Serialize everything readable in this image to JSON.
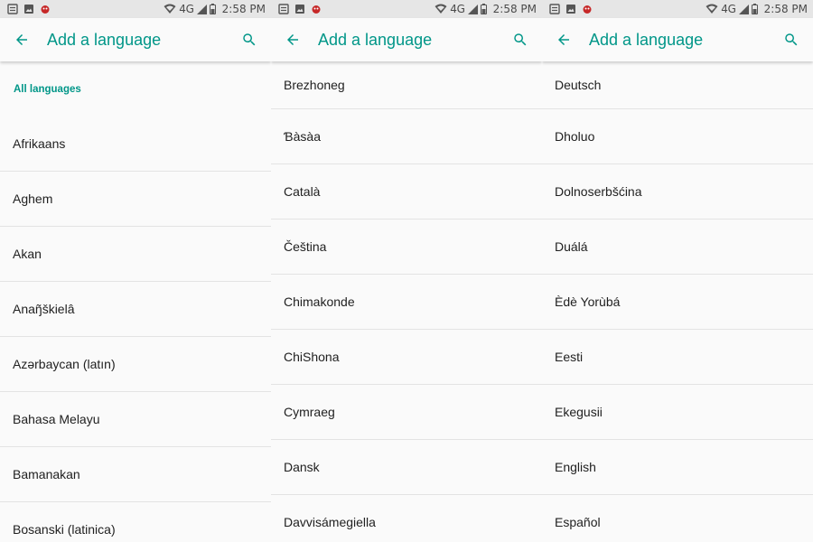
{
  "colors": {
    "accent": "#009688",
    "background": "#fafafa",
    "status_bar": "#e6e6e6",
    "divider": "#e3e3e3"
  },
  "status_bar": {
    "network": "4G",
    "time": "2:58 PM"
  },
  "app_bar": {
    "title": "Add a language",
    "back_icon": "arrow-left-icon",
    "search_icon": "search-icon"
  },
  "panels": [
    {
      "section_header": "All languages",
      "items": [
        "Afrikaans",
        "Aghem",
        "Akan",
        "Anaŋ̃škielâ",
        "Azərbaycan (latın)",
        "Bahasa Melayu",
        "Bamanakan",
        "Bosanski (latinica)"
      ]
    },
    {
      "items": [
        "Brezhoneg",
        "Ɓàsàa",
        "Català",
        "Čeština",
        "Chimakonde",
        "ChiShona",
        "Cymraeg",
        "Dansk",
        "Davvisámegiella"
      ]
    },
    {
      "items": [
        "Deutsch",
        "Dholuo",
        "Dolnoserbšćina",
        "Duálá",
        "Èdè Yorùbá",
        "Eesti",
        "Ekegusii",
        "English",
        "Español"
      ]
    }
  ]
}
